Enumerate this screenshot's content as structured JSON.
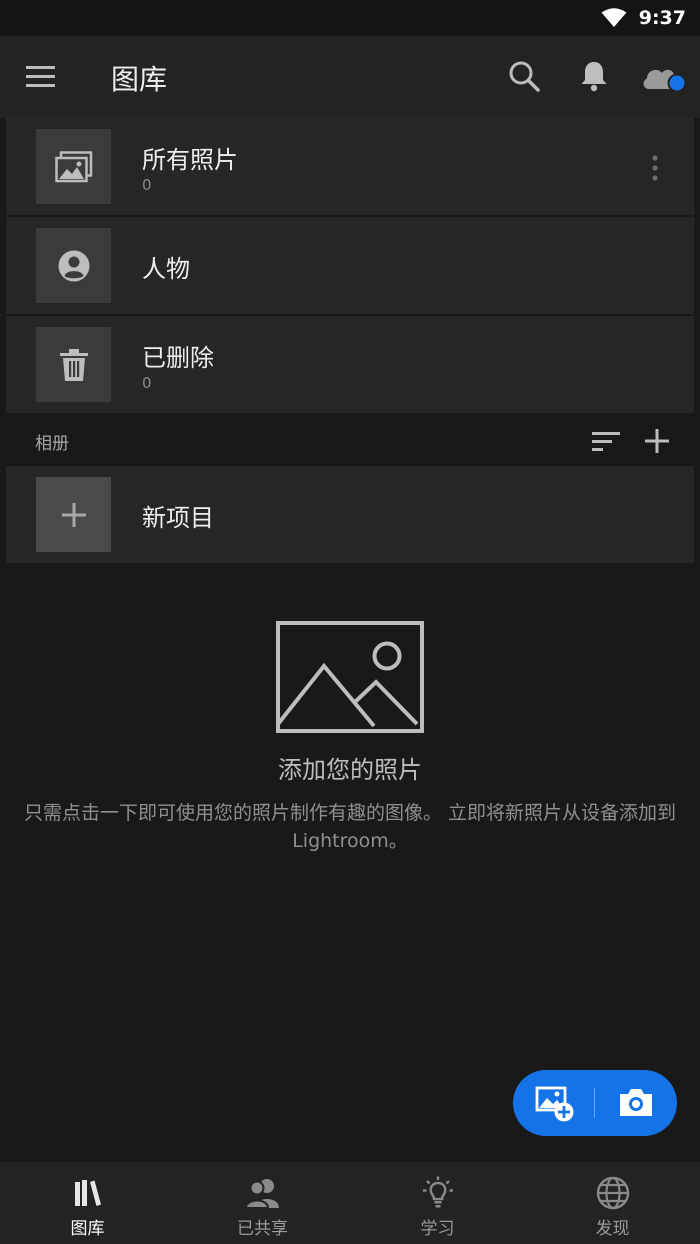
{
  "status_bar": {
    "time": "9:37"
  },
  "app_bar": {
    "title": "图库"
  },
  "library": {
    "items": [
      {
        "title": "所有照片",
        "count": "0"
      },
      {
        "title": "人物"
      },
      {
        "title": "已删除",
        "count": "0"
      }
    ]
  },
  "albums": {
    "label": "相册",
    "new_project_label": "新项目"
  },
  "empty_state": {
    "title": "添加您的照片",
    "description": "只需点击一下即可使用您的照片制作有趣的图像。 立即将新照片从设备添加到 Lightroom。"
  },
  "bottom_nav": {
    "items": [
      {
        "label": "图库",
        "icon": "library-icon",
        "active": true
      },
      {
        "label": "已共享",
        "icon": "shared-icon",
        "active": false
      },
      {
        "label": "学习",
        "icon": "learn-icon",
        "active": false
      },
      {
        "label": "发现",
        "icon": "discover-icon",
        "active": false
      }
    ]
  },
  "colors": {
    "accent": "#1473e6",
    "background": "#191919",
    "surface": "#262626",
    "cloud_dot": "#1473e6"
  }
}
